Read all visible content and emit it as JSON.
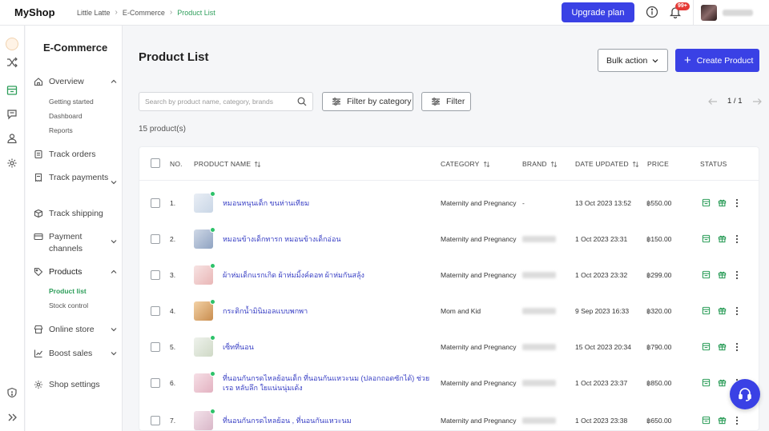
{
  "app": {
    "logo": "MyShop"
  },
  "breadcrumb": [
    "Little Latte",
    "E-Commerce",
    "Product List"
  ],
  "topbar": {
    "upgrade_label": "Upgrade plan",
    "notification_badge": "99+"
  },
  "sidebar": {
    "title": "E-Commerce",
    "items": [
      {
        "label": "Overview",
        "expanded": true,
        "sub": [
          "Getting started",
          "Dashboard",
          "Reports"
        ]
      },
      {
        "label": "Track orders"
      },
      {
        "label": "Track payments"
      },
      {
        "label": "Track shipping"
      },
      {
        "label": "Payment channels"
      },
      {
        "label": "Products",
        "expanded": true,
        "sub": [
          "Product list",
          "Stock control"
        ],
        "active_sub": "Product list"
      },
      {
        "label": "Online store"
      },
      {
        "label": "Boost sales"
      },
      {
        "label": "Shop settings"
      }
    ]
  },
  "main": {
    "title": "Product List",
    "bulk_action_label": "Bulk action",
    "create_label": "Create Product",
    "search_placeholder": "Search by product name, category, brands",
    "filter_category_label": "Filter by category",
    "filter_label": "Filter",
    "pagination": "1 / 1",
    "product_count": "15 product(s)"
  },
  "table": {
    "headers": {
      "no": "NO.",
      "name": "PRODUCT NAME",
      "category": "CATEGORY",
      "brand": "BRAND",
      "date": "DATE UPDATED",
      "price": "PRICE",
      "status": "STATUS"
    },
    "rows": [
      {
        "no": "1.",
        "name": "หมอนหนุนเด็ก ขนห่านเทียม",
        "category": "Maternity and Pregnancy",
        "brand": "-",
        "date": "13 Oct 2023 13:52",
        "price": "฿550.00"
      },
      {
        "no": "2.",
        "name": "หมอนข้างเด็กทารก หมอนข้างเด็กอ่อน",
        "category": "Maternity and Pregnancy",
        "brand": "",
        "date": "1 Oct 2023 23:31",
        "price": "฿150.00"
      },
      {
        "no": "3.",
        "name": "ผ้าห่มเด็กแรกเกิด ผ้าห่มมิ้งค์ดอท ผ้าห่มกันสลุ้ง",
        "category": "Maternity and Pregnancy",
        "brand": "",
        "date": "1 Oct 2023 23:32",
        "price": "฿299.00"
      },
      {
        "no": "4.",
        "name": "กระติกน้ำมินิมอลแบบพกพา",
        "category": "Mom and Kid",
        "brand": "",
        "date": "9 Sep 2023 16:33",
        "price": "฿320.00"
      },
      {
        "no": "5.",
        "name": "เซ็ทที่นอน",
        "category": "Maternity and Pregnancy",
        "brand": "",
        "date": "15 Oct 2023 20:34",
        "price": "฿790.00"
      },
      {
        "no": "6.",
        "name": "ที่นอนกันกรดไหลย้อนเด็ก ที่นอนกันแหวะนม (ปลอกถอดซักได้) ช่วยเรอ หลับลึก ใยแน่นนุ่มเด้ง",
        "category": "Maternity and Pregnancy",
        "brand": "",
        "date": "1 Oct 2023 23:37",
        "price": "฿850.00"
      },
      {
        "no": "7.",
        "name": "ที่นอนกันกรดไหลย้อน , ที่นอนกันแหวะนม",
        "category": "Maternity and Pregnancy",
        "brand": "",
        "date": "1 Oct 2023 23:38",
        "price": "฿650.00"
      }
    ]
  },
  "colors": {
    "primary": "#3a41e5",
    "accent_green": "#2e9e5b",
    "link": "#3a41c5"
  },
  "icons": [
    "info-icon",
    "bell-icon",
    "search-icon",
    "filter-icon",
    "sort-icon",
    "storefront-icon",
    "gift-icon",
    "more-vertical-icon",
    "headset-icon"
  ]
}
